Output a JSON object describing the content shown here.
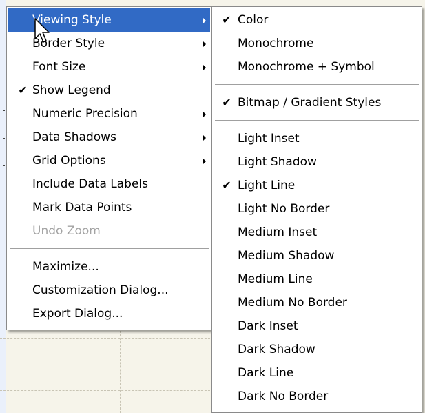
{
  "main_menu": {
    "items": [
      {
        "label": "Viewing Style",
        "checked": false,
        "submenu": true,
        "highlighted": true,
        "disabled": false
      },
      {
        "label": "Border Style",
        "checked": false,
        "submenu": true,
        "highlighted": false,
        "disabled": false
      },
      {
        "label": "Font Size",
        "checked": false,
        "submenu": true,
        "highlighted": false,
        "disabled": false
      },
      {
        "label": "Show Legend",
        "checked": true,
        "submenu": false,
        "highlighted": false,
        "disabled": false
      },
      {
        "label": "Numeric Precision",
        "checked": false,
        "submenu": true,
        "highlighted": false,
        "disabled": false
      },
      {
        "label": "Data Shadows",
        "checked": false,
        "submenu": true,
        "highlighted": false,
        "disabled": false
      },
      {
        "label": "Grid Options",
        "checked": false,
        "submenu": true,
        "highlighted": false,
        "disabled": false
      },
      {
        "label": "Include Data Labels",
        "checked": false,
        "submenu": false,
        "highlighted": false,
        "disabled": false
      },
      {
        "label": "Mark Data Points",
        "checked": false,
        "submenu": false,
        "highlighted": false,
        "disabled": false
      },
      {
        "label": "Undo Zoom",
        "checked": false,
        "submenu": false,
        "highlighted": false,
        "disabled": true
      }
    ],
    "items2": [
      {
        "label": "Maximize..."
      },
      {
        "label": "Customization Dialog..."
      },
      {
        "label": "Export Dialog..."
      }
    ]
  },
  "sub_menu": {
    "group1": [
      {
        "label": "Color",
        "checked": true
      },
      {
        "label": "Monochrome",
        "checked": false
      },
      {
        "label": "Monochrome + Symbol",
        "checked": false
      }
    ],
    "group2": [
      {
        "label": "Bitmap / Gradient Styles",
        "checked": true
      }
    ],
    "group3": [
      {
        "label": "Light Inset",
        "checked": false
      },
      {
        "label": "Light Shadow",
        "checked": false
      },
      {
        "label": "Light Line",
        "checked": true
      },
      {
        "label": "Light No Border",
        "checked": false
      },
      {
        "label": "Medium Inset",
        "checked": false
      },
      {
        "label": "Medium Shadow",
        "checked": false
      },
      {
        "label": "Medium Line",
        "checked": false
      },
      {
        "label": "Medium No Border",
        "checked": false
      },
      {
        "label": "Dark Inset",
        "checked": false
      },
      {
        "label": "Dark Shadow",
        "checked": false
      },
      {
        "label": "Dark Line",
        "checked": false
      },
      {
        "label": "Dark No Border",
        "checked": false
      }
    ]
  },
  "glyphs": {
    "check": "✔"
  },
  "colors": {
    "highlight": "#316ac5",
    "disabled_text": "#a3a3a3",
    "menu_bg": "#ffffff"
  }
}
